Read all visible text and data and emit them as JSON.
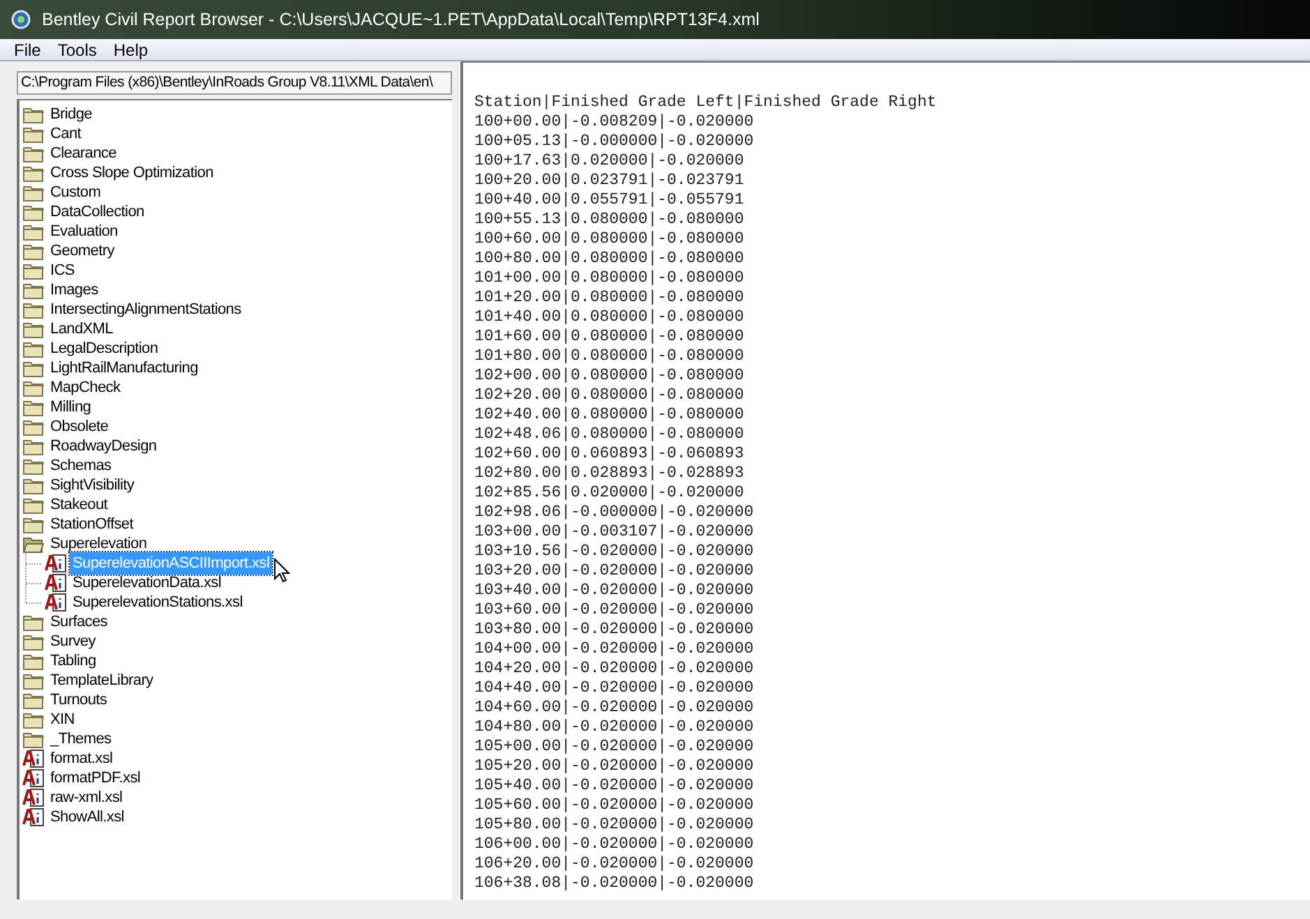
{
  "window": {
    "title": "Bentley Civil Report Browser - C:\\Users\\JACQUE~1.PET\\AppData\\Local\\Temp\\RPT13F4.xml"
  },
  "menu": [
    "File",
    "Tools",
    "Help"
  ],
  "path_field": {
    "value": "C:\\Program Files (x86)\\Bentley\\InRoads Group V8.11\\XML Data\\en\\"
  },
  "tree": [
    {
      "kind": "folder",
      "label": "Bridge",
      "selected": false,
      "expanded": false
    },
    {
      "kind": "folder",
      "label": "Cant",
      "selected": false,
      "expanded": false
    },
    {
      "kind": "folder",
      "label": "Clearance",
      "selected": false,
      "expanded": false
    },
    {
      "kind": "folder",
      "label": "Cross Slope Optimization",
      "selected": false,
      "expanded": false
    },
    {
      "kind": "folder",
      "label": "Custom",
      "selected": false,
      "expanded": false
    },
    {
      "kind": "folder",
      "label": "DataCollection",
      "selected": false,
      "expanded": false
    },
    {
      "kind": "folder",
      "label": "Evaluation",
      "selected": false,
      "expanded": false
    },
    {
      "kind": "folder",
      "label": "Geometry",
      "selected": false,
      "expanded": false
    },
    {
      "kind": "folder",
      "label": "ICS",
      "selected": false,
      "expanded": false
    },
    {
      "kind": "folder",
      "label": "Images",
      "selected": false,
      "expanded": false
    },
    {
      "kind": "folder",
      "label": "IntersectingAlignmentStations",
      "selected": false,
      "expanded": false
    },
    {
      "kind": "folder",
      "label": "LandXML",
      "selected": false,
      "expanded": false
    },
    {
      "kind": "folder",
      "label": "LegalDescription",
      "selected": false,
      "expanded": false
    },
    {
      "kind": "folder",
      "label": "LightRailManufacturing",
      "selected": false,
      "expanded": false
    },
    {
      "kind": "folder",
      "label": "MapCheck",
      "selected": false,
      "expanded": false
    },
    {
      "kind": "folder",
      "label": "Milling",
      "selected": false,
      "expanded": false
    },
    {
      "kind": "folder",
      "label": "Obsolete",
      "selected": false,
      "expanded": false
    },
    {
      "kind": "folder",
      "label": "RoadwayDesign",
      "selected": false,
      "expanded": false
    },
    {
      "kind": "folder",
      "label": "Schemas",
      "selected": false,
      "expanded": false
    },
    {
      "kind": "folder",
      "label": "SightVisibility",
      "selected": false,
      "expanded": false
    },
    {
      "kind": "folder",
      "label": "Stakeout",
      "selected": false,
      "expanded": false
    },
    {
      "kind": "folder",
      "label": "StationOffset",
      "selected": false,
      "expanded": false
    },
    {
      "kind": "folder",
      "label": "Superelevation",
      "selected": false,
      "expanded": true,
      "children": [
        {
          "kind": "file",
          "label": "SuperelevationASCIIImport.xsl",
          "selected": true
        },
        {
          "kind": "file",
          "label": "SuperelevationData.xsl",
          "selected": false
        },
        {
          "kind": "file",
          "label": "SuperelevationStations.xsl",
          "selected": false
        }
      ]
    },
    {
      "kind": "folder",
      "label": "Surfaces",
      "selected": false,
      "expanded": false
    },
    {
      "kind": "folder",
      "label": "Survey",
      "selected": false,
      "expanded": false
    },
    {
      "kind": "folder",
      "label": "Tabling",
      "selected": false,
      "expanded": false
    },
    {
      "kind": "folder",
      "label": "TemplateLibrary",
      "selected": false,
      "expanded": false
    },
    {
      "kind": "folder",
      "label": "Turnouts",
      "selected": false,
      "expanded": false
    },
    {
      "kind": "folder",
      "label": "XIN",
      "selected": false,
      "expanded": false
    },
    {
      "kind": "folder",
      "label": "_Themes",
      "selected": false,
      "expanded": false
    },
    {
      "kind": "file",
      "label": "format.xsl",
      "selected": false
    },
    {
      "kind": "file",
      "label": "formatPDF.xsl",
      "selected": false
    },
    {
      "kind": "file",
      "label": "raw-xml.xsl",
      "selected": false
    },
    {
      "kind": "file",
      "label": "ShowAll.xsl",
      "selected": false
    }
  ],
  "report": {
    "lines": [
      "Station|Finished Grade Left|Finished Grade Right",
      "100+00.00|-0.008209|-0.020000",
      "100+05.13|-0.000000|-0.020000",
      "100+17.63|0.020000|-0.020000",
      "100+20.00|0.023791|-0.023791",
      "100+40.00|0.055791|-0.055791",
      "100+55.13|0.080000|-0.080000",
      "100+60.00|0.080000|-0.080000",
      "100+80.00|0.080000|-0.080000",
      "101+00.00|0.080000|-0.080000",
      "101+20.00|0.080000|-0.080000",
      "101+40.00|0.080000|-0.080000",
      "101+60.00|0.080000|-0.080000",
      "101+80.00|0.080000|-0.080000",
      "102+00.00|0.080000|-0.080000",
      "102+20.00|0.080000|-0.080000",
      "102+40.00|0.080000|-0.080000",
      "102+48.06|0.080000|-0.080000",
      "102+60.00|0.060893|-0.060893",
      "102+80.00|0.028893|-0.028893",
      "102+85.56|0.020000|-0.020000",
      "102+98.06|-0.000000|-0.020000",
      "103+00.00|-0.003107|-0.020000",
      "103+10.56|-0.020000|-0.020000",
      "103+20.00|-0.020000|-0.020000",
      "103+40.00|-0.020000|-0.020000",
      "103+60.00|-0.020000|-0.020000",
      "103+80.00|-0.020000|-0.020000",
      "104+00.00|-0.020000|-0.020000",
      "104+20.00|-0.020000|-0.020000",
      "104+40.00|-0.020000|-0.020000",
      "104+60.00|-0.020000|-0.020000",
      "104+80.00|-0.020000|-0.020000",
      "105+00.00|-0.020000|-0.020000",
      "105+20.00|-0.020000|-0.020000",
      "105+40.00|-0.020000|-0.020000",
      "105+60.00|-0.020000|-0.020000",
      "105+80.00|-0.020000|-0.020000",
      "106+00.00|-0.020000|-0.020000",
      "106+20.00|-0.020000|-0.020000",
      "106+38.08|-0.020000|-0.020000"
    ]
  }
}
